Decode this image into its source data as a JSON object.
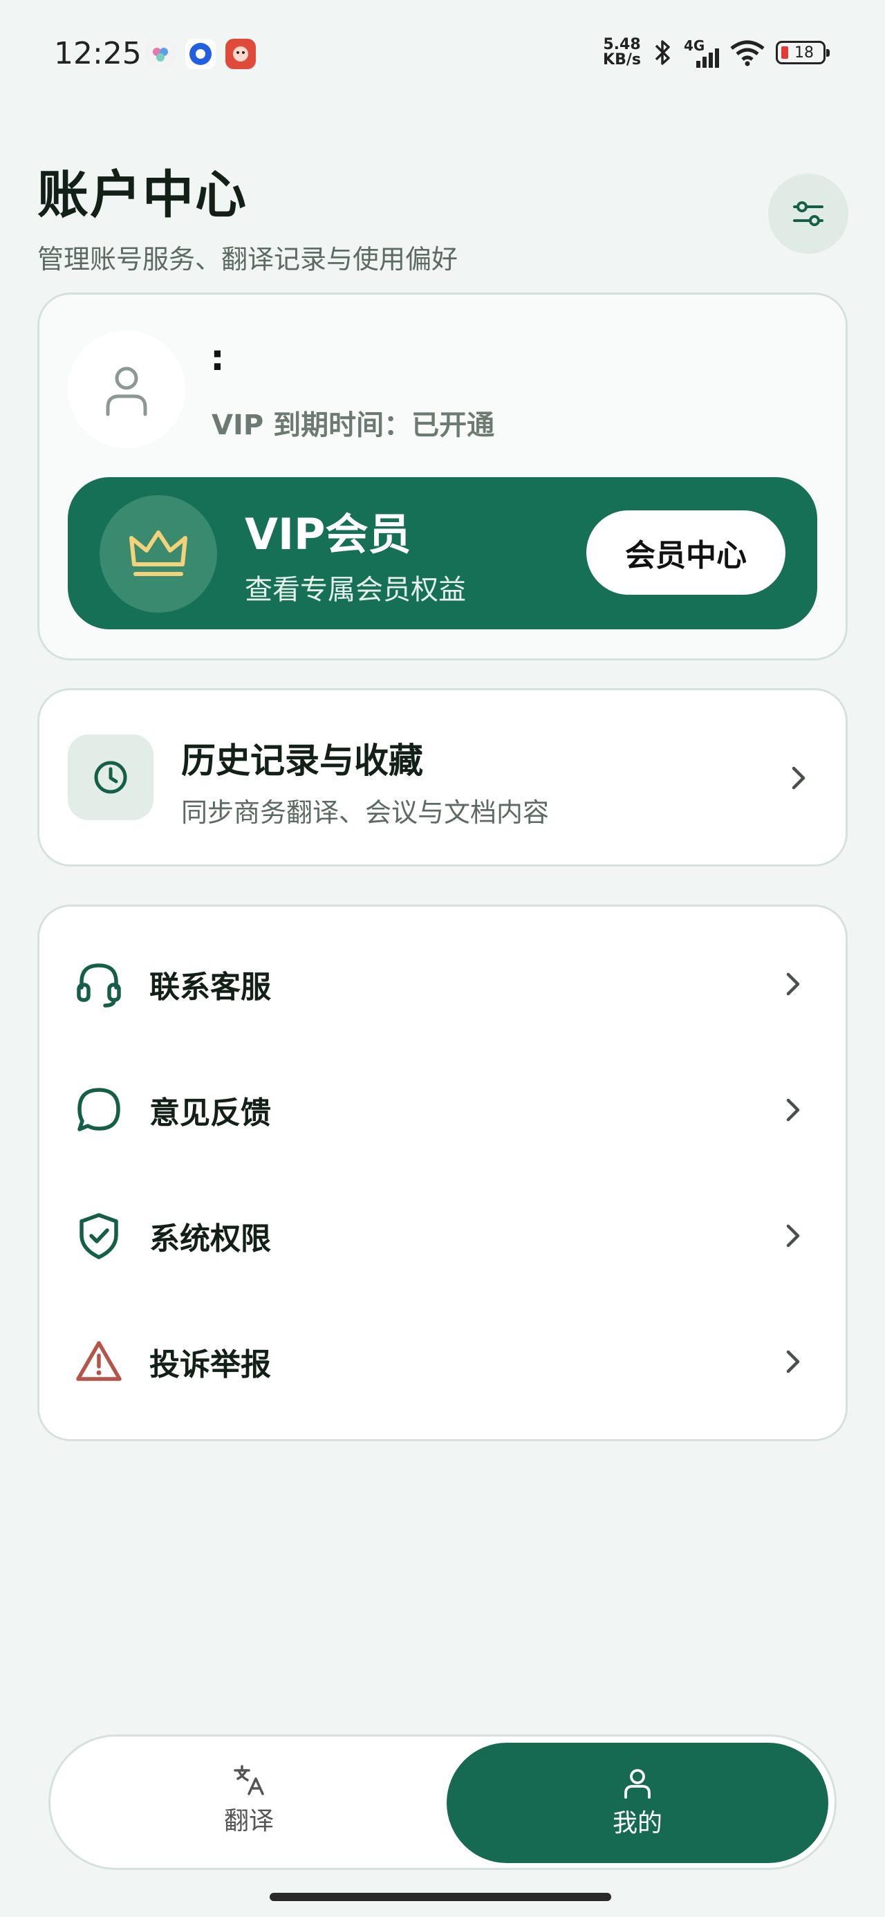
{
  "status_bar": {
    "time": "12:25",
    "net_speed_value": "5.48",
    "net_speed_unit": "KB/s",
    "network": "4G",
    "battery": "18"
  },
  "header": {
    "title": "账户中心",
    "subtitle": "管理账号服务、翻译记录与使用偏好"
  },
  "account": {
    "user_name": ":",
    "vip_expire": "VIP 到期时间：已开通"
  },
  "vip_banner": {
    "title": "VIP会员",
    "desc": "查看专属会员权益",
    "button_label": "会员中心"
  },
  "history": {
    "title": "历史记录与收藏",
    "desc": "同步商务翻译、会议与文档内容"
  },
  "menu": {
    "items": [
      {
        "label": "联系客服",
        "icon": "headset-icon"
      },
      {
        "label": "意见反馈",
        "icon": "chat-bubble-icon"
      },
      {
        "label": "系统权限",
        "icon": "shield-check-icon"
      },
      {
        "label": "投诉举报",
        "icon": "warning-triangle-icon"
      }
    ]
  },
  "bottom_nav": {
    "translate_label": "翻译",
    "mine_label": "我的"
  },
  "colors": {
    "accent": "#157055",
    "warning": "#b5554a",
    "crown": "#f3d27a"
  }
}
